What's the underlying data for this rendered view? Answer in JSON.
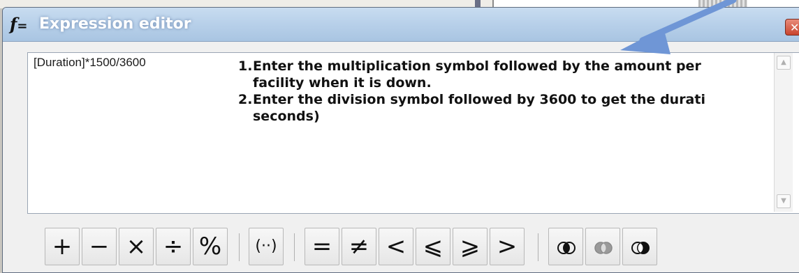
{
  "window": {
    "title": "Expression editor",
    "icon": "function-icon",
    "close_icon": "close-icon"
  },
  "editor": {
    "expression": "[Duration]*1500/3600"
  },
  "instructions": [
    {
      "number": "1.",
      "line1": "Enter the multiplication symbol followed by the amount per",
      "line2": "facility when it is down."
    },
    {
      "number": "2.",
      "line1": "Enter the division symbol followed by 3600 to get the durati",
      "line2": "seconds)"
    }
  ],
  "operators": {
    "plus": "+",
    "minus": "−",
    "times": "×",
    "divide": "÷",
    "percent": "%",
    "parentheses": "(··)",
    "equals": "=",
    "not_equal": "≠",
    "less_than": "<",
    "less_equal": "⩽",
    "greater_equal": "⩾",
    "greater_than": ">"
  },
  "colors": {
    "arrow": "#6f96d6",
    "title_text": "#ffffff",
    "titlebar": "#b9d1ea"
  }
}
